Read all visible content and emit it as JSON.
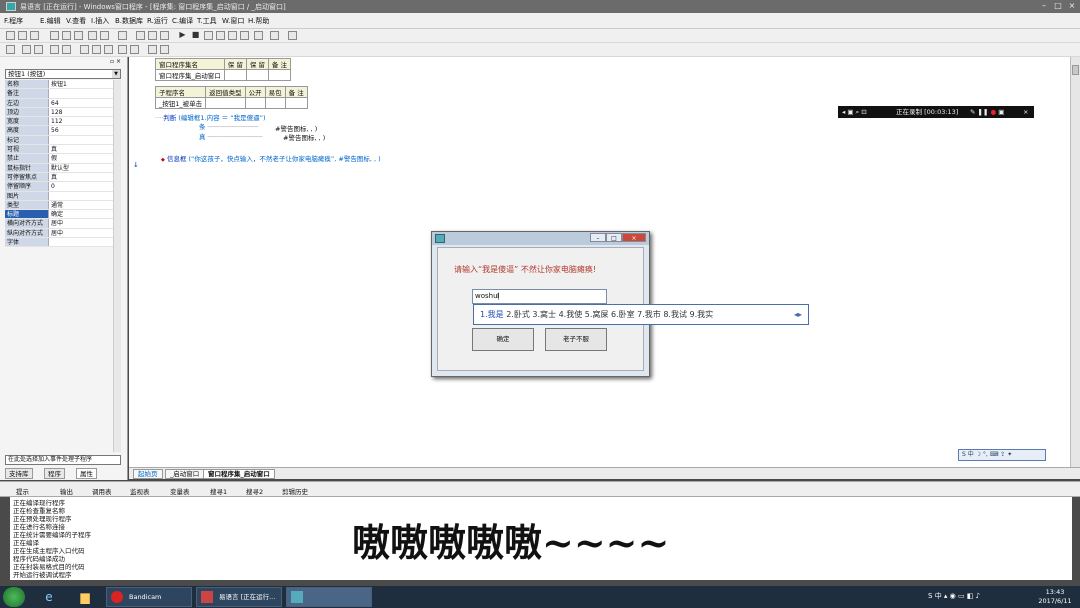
{
  "window": {
    "title": "易语言 [正在运行] - Windows窗口程序 - [程序集: 窗口程序集_启动窗口 / _启动窗口]"
  },
  "menu": [
    "F.程序",
    "E.编辑",
    "V.查看",
    "I.插入",
    "B.数据库",
    "R.运行",
    "C.编译",
    "T.工具",
    "W.窗口",
    "H.帮助"
  ],
  "left_panel": {
    "selected_component": "按钮1 (按钮)",
    "properties": [
      {
        "k": "名称",
        "v": "按钮1"
      },
      {
        "k": "备注",
        "v": ""
      },
      {
        "k": "左边",
        "v": "64"
      },
      {
        "k": "顶边",
        "v": "128"
      },
      {
        "k": "宽度",
        "v": "112"
      },
      {
        "k": "高度",
        "v": "56"
      },
      {
        "k": "标记",
        "v": ""
      },
      {
        "k": "可视",
        "v": "真"
      },
      {
        "k": "禁止",
        "v": "假"
      },
      {
        "k": "鼠标指针",
        "v": "默认型"
      },
      {
        "k": "可停留焦点",
        "v": "真"
      },
      {
        "k": "停留顺序",
        "v": "0"
      },
      {
        "k": "图片",
        "v": ""
      },
      {
        "k": "类型",
        "v": "通常"
      },
      {
        "k": "标题",
        "v": "确定"
      },
      {
        "k": "横向对齐方式",
        "v": "居中"
      },
      {
        "k": "纵向对齐方式",
        "v": "居中"
      },
      {
        "k": "字体",
        "v": ""
      }
    ],
    "event_select": "在此处选择加入事件处理子程序",
    "tabs": [
      "支持库",
      "程序",
      "属性"
    ]
  },
  "editor": {
    "assembly_table": {
      "headers": [
        "窗口程序集名",
        "保 留",
        "保 留",
        "备 注"
      ],
      "row": [
        "窗口程序集_启动窗口",
        "",
        "",
        ""
      ]
    },
    "sub_table": {
      "headers": [
        "子程序名",
        "返回值类型",
        "公开",
        "易包",
        "备 注"
      ],
      "row": [
        "_按钮1_被单击",
        "",
        "",
        "",
        ""
      ]
    },
    "code": {
      "l1_kw": "判断",
      "l1_rest": "(编辑框1.内容 ＝ “我是傻逼”)",
      "l2": "条",
      "l2_tail": "#警告图标, , )",
      "l3": "真",
      "l3_tail": "#警告图标, , )",
      "l4_kw": "信息框",
      "l4_rest": "(“你这孩子，快点输入，不然老子让你家电脑瘫痪”, #警告图标, , )"
    }
  },
  "recorder": {
    "status": "正在录制 [00:03:13]"
  },
  "dialog": {
    "prompt": "请输入“我是傻逼” 不然让你家电脑瘫痪!",
    "input_value": "woshu",
    "ok_button": "确定",
    "cancel_button": "老子不服"
  },
  "ime": {
    "candidates": [
      "1.我是",
      "2.卧式",
      "3.窝士",
      "4.我使",
      "5.窝屎",
      "6.卧室",
      "7.我市",
      "8.我试",
      "9.我实"
    ]
  },
  "doc_tabs": [
    "起始页",
    "_启动窗口",
    "窗口程序集_启动窗口"
  ],
  "bottom_tabs": [
    "提示",
    "输出",
    "调用表",
    "监视表",
    "变量表",
    "搜寻1",
    "搜寻2",
    "剪辑历史"
  ],
  "output_lines": [
    "正在编译现行程序",
    "正在检查重复名称",
    "正在预处理现行程序",
    "正在进行名称连接",
    "正在统计需要编译的子程序",
    "正在编译",
    "正在生成主程序入口代码",
    "程序代码编译成功",
    "正在封装易格式目的代码",
    "开始运行被调试程序"
  ],
  "caption": "嗷嗷嗷嗷嗷~~~~",
  "taskbar": {
    "apps": [
      "Bandicam",
      "易语言 [正在运行...",
      ""
    ],
    "tray": "中",
    "time": "13:43",
    "date": "2017/6/11"
  }
}
